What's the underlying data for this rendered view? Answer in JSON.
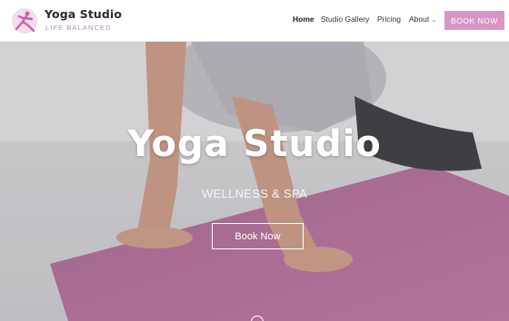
{
  "brand": {
    "title": "Yoga Studio",
    "tagline": "LIFE BALANCED",
    "logo_icon": "yoga-pose-logo-icon",
    "accent_color": "#d896c6"
  },
  "nav": {
    "items": [
      {
        "label": "Home",
        "active": true
      },
      {
        "label": "Studio Gallery",
        "active": false
      },
      {
        "label": "Pricing",
        "active": false
      },
      {
        "label": "About",
        "active": false,
        "has_dropdown": true
      }
    ],
    "dropdown_icon": "chevron-down-icon",
    "book_button": "BOOK NOW"
  },
  "hero": {
    "title": "Yoga Studio",
    "subtitle": "WELLNESS & SPA",
    "button": "Book Now",
    "scroll_icon": "scroll-down-icon"
  }
}
